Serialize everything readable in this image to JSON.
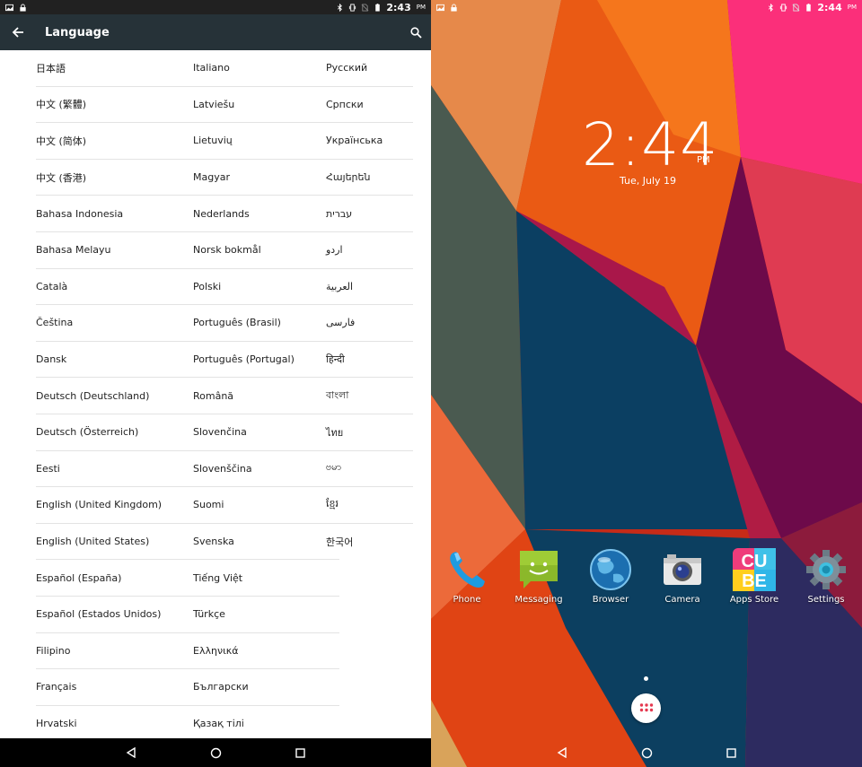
{
  "left": {
    "status": {
      "time": "2:43",
      "ampm": "PM"
    },
    "toolbar": {
      "title": "Language"
    },
    "languages": {
      "col1": [
        "日本語",
        "中文 (繁體)",
        "中文 (简体)",
        "中文 (香港)",
        "Bahasa Indonesia",
        "Bahasa Melayu",
        "Català",
        "Čeština",
        "Dansk",
        "Deutsch (Deutschland)",
        "Deutsch (Österreich)",
        "Eesti",
        "English (United Kingdom)",
        "English (United States)",
        "Español (España)",
        "Español (Estados Unidos)",
        "Filipino",
        "Français",
        "Hrvatski"
      ],
      "col2": [
        "Italiano",
        "Latviešu",
        "Lietuvių",
        "Magyar",
        "Nederlands",
        "Norsk bokmål",
        "Polski",
        "Português (Brasil)",
        "Português (Portugal)",
        "Română",
        "Slovenčina",
        "Slovenščina",
        "Suomi",
        "Svenska",
        "Tiếng Việt",
        "Türkçe",
        "Ελληνικά",
        "Български",
        "Қазақ тілі"
      ],
      "col3": [
        "Русский",
        "Српски",
        "Українська",
        "Հայերեն",
        "עברית",
        "اردو",
        "العربية",
        "فارسی",
        "हिन्दी",
        "বাংলা",
        "ไทย",
        "ဗမာ",
        "ខ្មែរ",
        "한국어"
      ]
    }
  },
  "right": {
    "status": {
      "time": "2:44",
      "ampm": "PM"
    },
    "clock": {
      "time": "2:44",
      "ampm": "PM",
      "date": "Tue, July 19"
    },
    "dock": [
      {
        "label": "Phone",
        "icon": "phone-icon"
      },
      {
        "label": "Messaging",
        "icon": "messaging-icon"
      },
      {
        "label": "Browser",
        "icon": "browser-icon"
      },
      {
        "label": "Camera",
        "icon": "camera-icon"
      },
      {
        "label": "Apps Store",
        "icon": "apps-store-icon"
      },
      {
        "label": "Settings",
        "icon": "settings-icon"
      }
    ],
    "apps_store_logo": {
      "line1": "CU",
      "line2": "BE"
    }
  }
}
